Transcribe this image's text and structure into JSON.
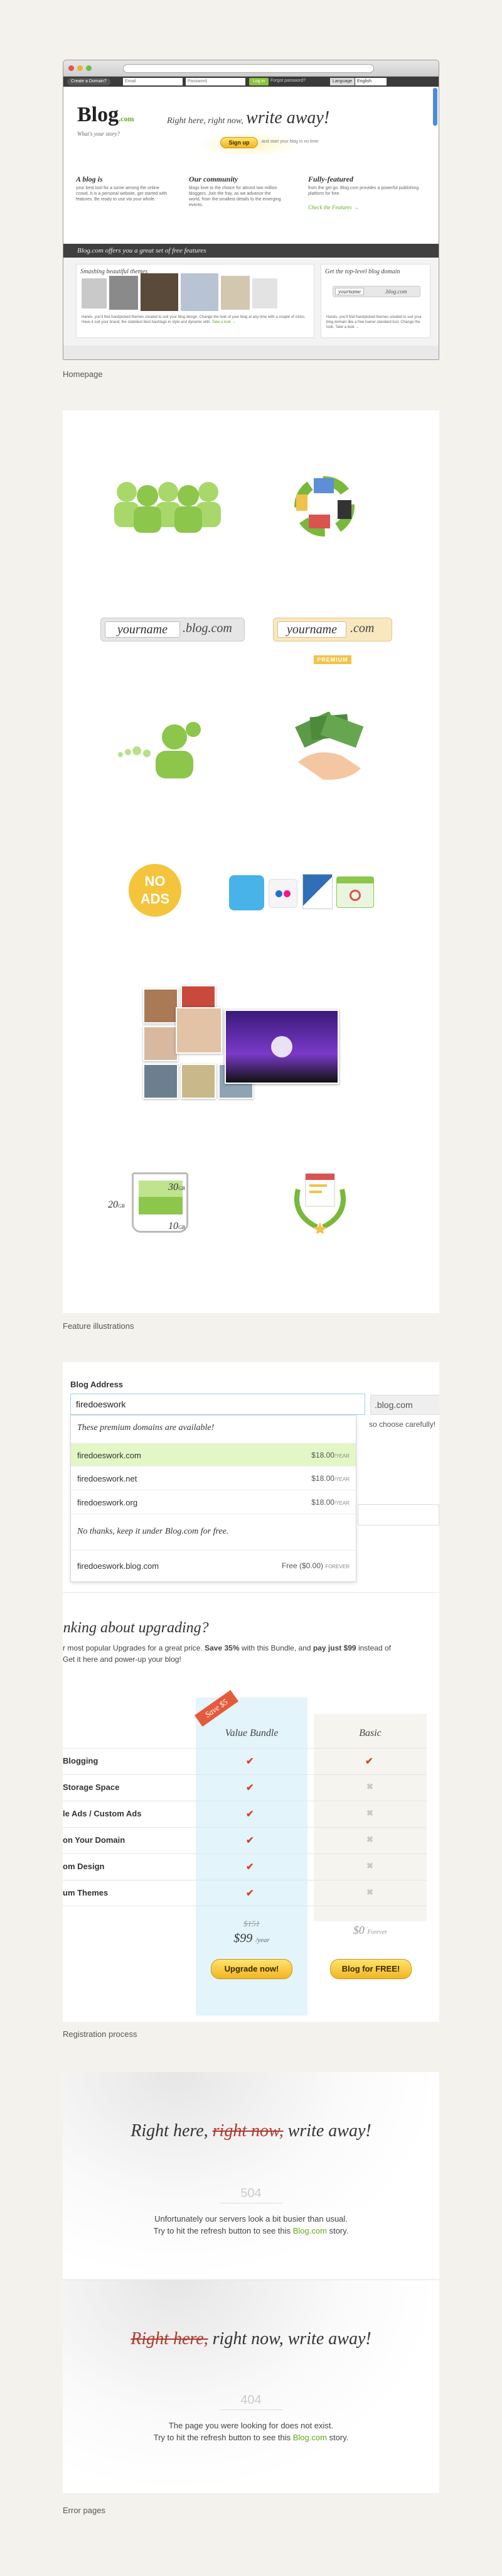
{
  "captions": {
    "homepage": "Homepage",
    "features": "Feature illustrations",
    "registration": "Registration process",
    "errors": "Error pages"
  },
  "homepage": {
    "topbar": {
      "create_button": "Create a Domain?",
      "field1": "Email",
      "field2": "Password",
      "login": "Log in",
      "forgot": "Forgot password?",
      "language_label": "Language",
      "language_value": "English"
    },
    "logo_word": "Blog",
    "logo_sub": ".com",
    "tagline": "What's your story?",
    "hero_small": "Right here, right now,",
    "hero_big": "write away!",
    "signup_button": "Sign up",
    "signup_note": "and start your blog in no time",
    "features": [
      {
        "title": "A blog is",
        "text": "your best tool for a some among the online crowd. It is a personal website, get started with features. Be ready to use via your whole."
      },
      {
        "title": "Our community",
        "text": "blogs love to the choice for almost two million bloggers. Join the fray, as we advance the world, from the smallest details to the emerging events."
      },
      {
        "title": "Fully-featured",
        "text": "from the get go. Blog.com provides a powerful publishing platform for free."
      }
    ],
    "check_features": "Check the Features →",
    "banner": "Blog.com offers you a great set of free features",
    "themes_title": "Smashing beautiful themes",
    "themes_text": "Hands, you'll find handpicked themes created to suit your blog design. Change the look of your blog at any time with a couple of clicks. Have it suit your brand, the stateliest best hashtags in style and dynamic with.",
    "themes_link": "Take a look →",
    "domain_title": "Get the top-level blog domain",
    "domain_yourname": "yourname",
    "domain_suffix": ".blog.com",
    "domain_text": "Hands, you'll find handpicked themes created to suit your blog domain like a free loaner standard tool. Change the look. Take a look →"
  },
  "illustrations": {
    "domain_label_1": "yourname",
    "domain_suffix_1": ".blog.com",
    "domain_label_2": "yourname",
    "domain_suffix_2": ".com",
    "premium_badge": "PREMIUM",
    "noads_line1": "NO",
    "noads_line2": "ADS",
    "storage": {
      "top": "30",
      "mid": "20",
      "bot": "10",
      "unit": "GB"
    }
  },
  "registration": {
    "blog_address_label": "Blog Address",
    "input_value": "firedoeswork",
    "suffix": ".blog.com",
    "side_note": "so choose carefully!",
    "dropdown_header": "These premium domains are available!",
    "domains": [
      {
        "name": "firedoeswork.com",
        "price": "$18.00",
        "period": "/YEAR"
      },
      {
        "name": "firedoeswork.net",
        "price": "$18.00",
        "period": "/YEAR"
      },
      {
        "name": "firedoeswork.org",
        "price": "$18.00",
        "period": "/YEAR"
      }
    ],
    "no_thanks": "No thanks, keep it under Blog.com for free.",
    "free_domain": {
      "name": "firedoeswork.blog.com",
      "price": "Free ($0.00)",
      "period": "FOREVER"
    },
    "upgrade_title": "inking about upgrading?",
    "upgrade_text_1": "r most popular Upgrades for a great price. ",
    "upgrade_text_bold": "Save 35%",
    "upgrade_text_2": " with this Bundle, and ",
    "upgrade_text_bold2": "pay just $99",
    "upgrade_text_3": " instead of",
    "upgrade_text_line2": "Get it here and power-up your blog!",
    "ribbon": "Save $5",
    "col_bundle": "Value Bundle",
    "col_basic": "Basic",
    "rows": [
      {
        "label": "Blogging",
        "bundle": "✔",
        "basic": "✔"
      },
      {
        "label": "Storage Space",
        "bundle": "✔",
        "basic": "✖"
      },
      {
        "label": "le Ads / Custom Ads",
        "bundle": "✔",
        "basic": "✖"
      },
      {
        "label": "on Your Domain",
        "bundle": "✔",
        "basic": "✖"
      },
      {
        "label": "om Design",
        "bundle": "✔",
        "basic": "✖"
      },
      {
        "label": "um Themes",
        "bundle": "✔",
        "basic": "✖"
      }
    ],
    "old_price": "$151",
    "new_price": "$99",
    "new_price_period": "/year",
    "basic_price": "$0",
    "basic_price_period": "Forever",
    "upgrade_button": "Upgrade now!",
    "free_button": "Blog for FREE!"
  },
  "errors": [
    {
      "pre": "Right here, ",
      "strike": "right now,",
      "post": " write away!",
      "code": "504",
      "line1": "Unfortunately our servers look a bit busier than usual.",
      "line2_pre": "Try to hit the refresh button to see this ",
      "link": "Blog.com",
      "line2_post": " story."
    },
    {
      "strike": "Right here,",
      "post": " right now,  write away!",
      "code": "404",
      "line1": "The page you were looking for does not exist.",
      "line2_pre": "Try to hit the refresh button to see this ",
      "link": "Blog.com",
      "line2_post": " story."
    }
  ]
}
